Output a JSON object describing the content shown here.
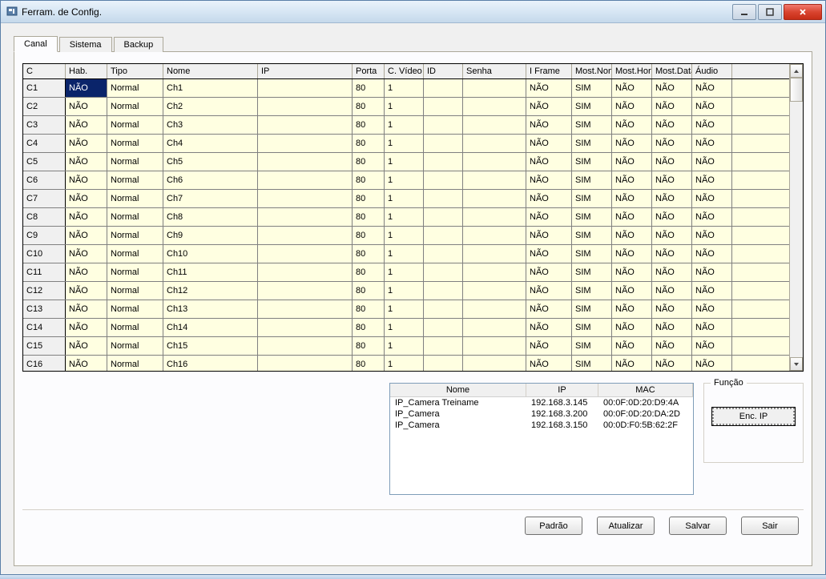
{
  "window": {
    "title": "Ferram. de Config."
  },
  "tabs": [
    {
      "label": "Canal",
      "active": true
    },
    {
      "label": "Sistema",
      "active": false
    },
    {
      "label": "Backup",
      "active": false
    }
  ],
  "columns": [
    "C",
    "Hab.",
    "Tipo",
    "Nome",
    "IP",
    "Porta",
    "C. Vídeo",
    "ID",
    "Senha",
    "I Frame",
    "Most.Nome",
    "Most.Hora",
    "Most.Data",
    "Áudio"
  ],
  "rows": [
    {
      "c": "C1",
      "hab": "NÃO",
      "tipo": "Normal",
      "nome": "Ch1",
      "ip": "",
      "porta": "80",
      "cv": "1",
      "id": "",
      "senha": "",
      "iframe": "NÃO",
      "mn": "SIM",
      "mh": "NÃO",
      "md": "NÃO",
      "au": "NÃO",
      "sel": true
    },
    {
      "c": "C2",
      "hab": "NÃO",
      "tipo": "Normal",
      "nome": "Ch2",
      "ip": "",
      "porta": "80",
      "cv": "1",
      "id": "",
      "senha": "",
      "iframe": "NÃO",
      "mn": "SIM",
      "mh": "NÃO",
      "md": "NÃO",
      "au": "NÃO"
    },
    {
      "c": "C3",
      "hab": "NÃO",
      "tipo": "Normal",
      "nome": "Ch3",
      "ip": "",
      "porta": "80",
      "cv": "1",
      "id": "",
      "senha": "",
      "iframe": "NÃO",
      "mn": "SIM",
      "mh": "NÃO",
      "md": "NÃO",
      "au": "NÃO"
    },
    {
      "c": "C4",
      "hab": "NÃO",
      "tipo": "Normal",
      "nome": "Ch4",
      "ip": "",
      "porta": "80",
      "cv": "1",
      "id": "",
      "senha": "",
      "iframe": "NÃO",
      "mn": "SIM",
      "mh": "NÃO",
      "md": "NÃO",
      "au": "NÃO"
    },
    {
      "c": "C5",
      "hab": "NÃO",
      "tipo": "Normal",
      "nome": "Ch5",
      "ip": "",
      "porta": "80",
      "cv": "1",
      "id": "",
      "senha": "",
      "iframe": "NÃO",
      "mn": "SIM",
      "mh": "NÃO",
      "md": "NÃO",
      "au": "NÃO"
    },
    {
      "c": "C6",
      "hab": "NÃO",
      "tipo": "Normal",
      "nome": "Ch6",
      "ip": "",
      "porta": "80",
      "cv": "1",
      "id": "",
      "senha": "",
      "iframe": "NÃO",
      "mn": "SIM",
      "mh": "NÃO",
      "md": "NÃO",
      "au": "NÃO"
    },
    {
      "c": "C7",
      "hab": "NÃO",
      "tipo": "Normal",
      "nome": "Ch7",
      "ip": "",
      "porta": "80",
      "cv": "1",
      "id": "",
      "senha": "",
      "iframe": "NÃO",
      "mn": "SIM",
      "mh": "NÃO",
      "md": "NÃO",
      "au": "NÃO"
    },
    {
      "c": "C8",
      "hab": "NÃO",
      "tipo": "Normal",
      "nome": "Ch8",
      "ip": "",
      "porta": "80",
      "cv": "1",
      "id": "",
      "senha": "",
      "iframe": "NÃO",
      "mn": "SIM",
      "mh": "NÃO",
      "md": "NÃO",
      "au": "NÃO"
    },
    {
      "c": "C9",
      "hab": "NÃO",
      "tipo": "Normal",
      "nome": "Ch9",
      "ip": "",
      "porta": "80",
      "cv": "1",
      "id": "",
      "senha": "",
      "iframe": "NÃO",
      "mn": "SIM",
      "mh": "NÃO",
      "md": "NÃO",
      "au": "NÃO"
    },
    {
      "c": "C10",
      "hab": "NÃO",
      "tipo": "Normal",
      "nome": "Ch10",
      "ip": "",
      "porta": "80",
      "cv": "1",
      "id": "",
      "senha": "",
      "iframe": "NÃO",
      "mn": "SIM",
      "mh": "NÃO",
      "md": "NÃO",
      "au": "NÃO"
    },
    {
      "c": "C11",
      "hab": "NÃO",
      "tipo": "Normal",
      "nome": "Ch11",
      "ip": "",
      "porta": "80",
      "cv": "1",
      "id": "",
      "senha": "",
      "iframe": "NÃO",
      "mn": "SIM",
      "mh": "NÃO",
      "md": "NÃO",
      "au": "NÃO"
    },
    {
      "c": "C12",
      "hab": "NÃO",
      "tipo": "Normal",
      "nome": "Ch12",
      "ip": "",
      "porta": "80",
      "cv": "1",
      "id": "",
      "senha": "",
      "iframe": "NÃO",
      "mn": "SIM",
      "mh": "NÃO",
      "md": "NÃO",
      "au": "NÃO"
    },
    {
      "c": "C13",
      "hab": "NÃO",
      "tipo": "Normal",
      "nome": "Ch13",
      "ip": "",
      "porta": "80",
      "cv": "1",
      "id": "",
      "senha": "",
      "iframe": "NÃO",
      "mn": "SIM",
      "mh": "NÃO",
      "md": "NÃO",
      "au": "NÃO"
    },
    {
      "c": "C14",
      "hab": "NÃO",
      "tipo": "Normal",
      "nome": "Ch14",
      "ip": "",
      "porta": "80",
      "cv": "1",
      "id": "",
      "senha": "",
      "iframe": "NÃO",
      "mn": "SIM",
      "mh": "NÃO",
      "md": "NÃO",
      "au": "NÃO"
    },
    {
      "c": "C15",
      "hab": "NÃO",
      "tipo": "Normal",
      "nome": "Ch15",
      "ip": "",
      "porta": "80",
      "cv": "1",
      "id": "",
      "senha": "",
      "iframe": "NÃO",
      "mn": "SIM",
      "mh": "NÃO",
      "md": "NÃO",
      "au": "NÃO"
    },
    {
      "c": "C16",
      "hab": "NÃO",
      "tipo": "Normal",
      "nome": "Ch16",
      "ip": "",
      "porta": "80",
      "cv": "1",
      "id": "",
      "senha": "",
      "iframe": "NÃO",
      "mn": "SIM",
      "mh": "NÃO",
      "md": "NÃO",
      "au": "NÃO"
    }
  ],
  "device_columns": [
    "Nome",
    "IP",
    "MAC"
  ],
  "devices": [
    {
      "nome": "IP_Camera Treiname",
      "ip": "192.168.3.145",
      "mac": "00:0F:0D:20:D9:4A"
    },
    {
      "nome": "IP_Camera",
      "ip": "192.168.3.200",
      "mac": "00:0F:0D:20:DA:2D"
    },
    {
      "nome": "IP_Camera",
      "ip": "192.168.3.150",
      "mac": "00:0D:F0:5B:62:2F"
    }
  ],
  "func": {
    "legend": "Função",
    "button": "Enc. IP"
  },
  "buttons": {
    "padrao": "Padrão",
    "atualizar": "Atualizar",
    "salvar": "Salvar",
    "sair": "Sair"
  }
}
